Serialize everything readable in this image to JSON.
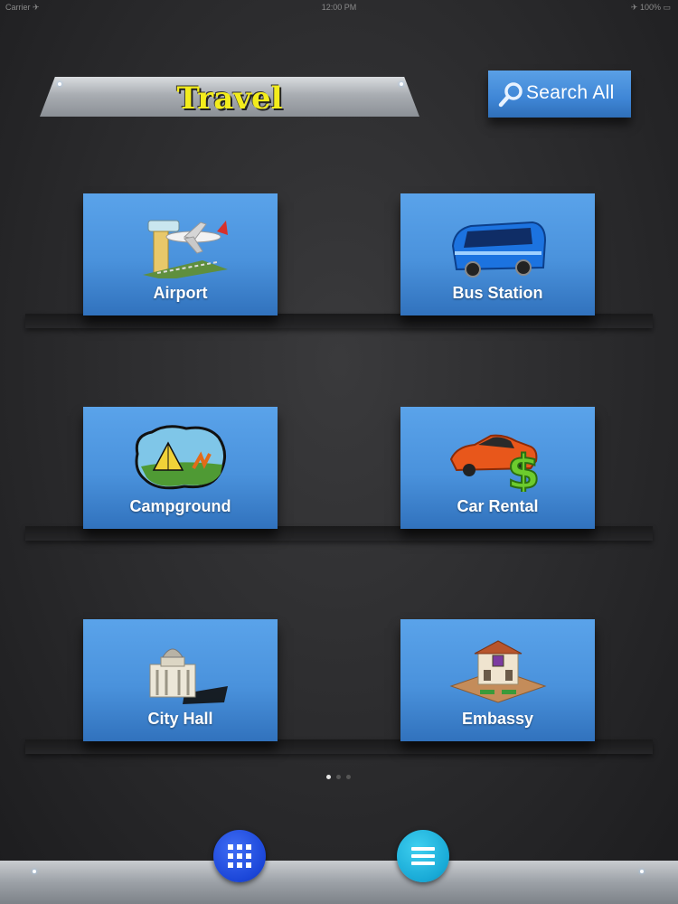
{
  "status_bar": {
    "carrier": "Carrier ✈",
    "time": "12:00 PM",
    "battery": "✈ 100% ▭"
  },
  "header": {
    "title": "Travel",
    "search_label": "Search All"
  },
  "tiles": [
    {
      "label": "Airport",
      "icon": "airport-icon"
    },
    {
      "label": "Bus Station",
      "icon": "bus-icon"
    },
    {
      "label": "Campground",
      "icon": "campground-icon"
    },
    {
      "label": "Car Rental",
      "icon": "car-rental-icon"
    },
    {
      "label": "City Hall",
      "icon": "city-hall-icon"
    },
    {
      "label": "Embassy",
      "icon": "embassy-icon"
    }
  ],
  "pager": {
    "pages": 3,
    "current": 1
  },
  "bottom_nav": [
    {
      "name": "grid-view",
      "icon": "grid-icon",
      "color": "#1b46d8"
    },
    {
      "name": "list-view",
      "icon": "menu-icon",
      "color": "#18a9d6"
    }
  ],
  "colors": {
    "accent": "#4a92dc",
    "title": "#f3ec1c",
    "background": "#2a2a2c"
  }
}
